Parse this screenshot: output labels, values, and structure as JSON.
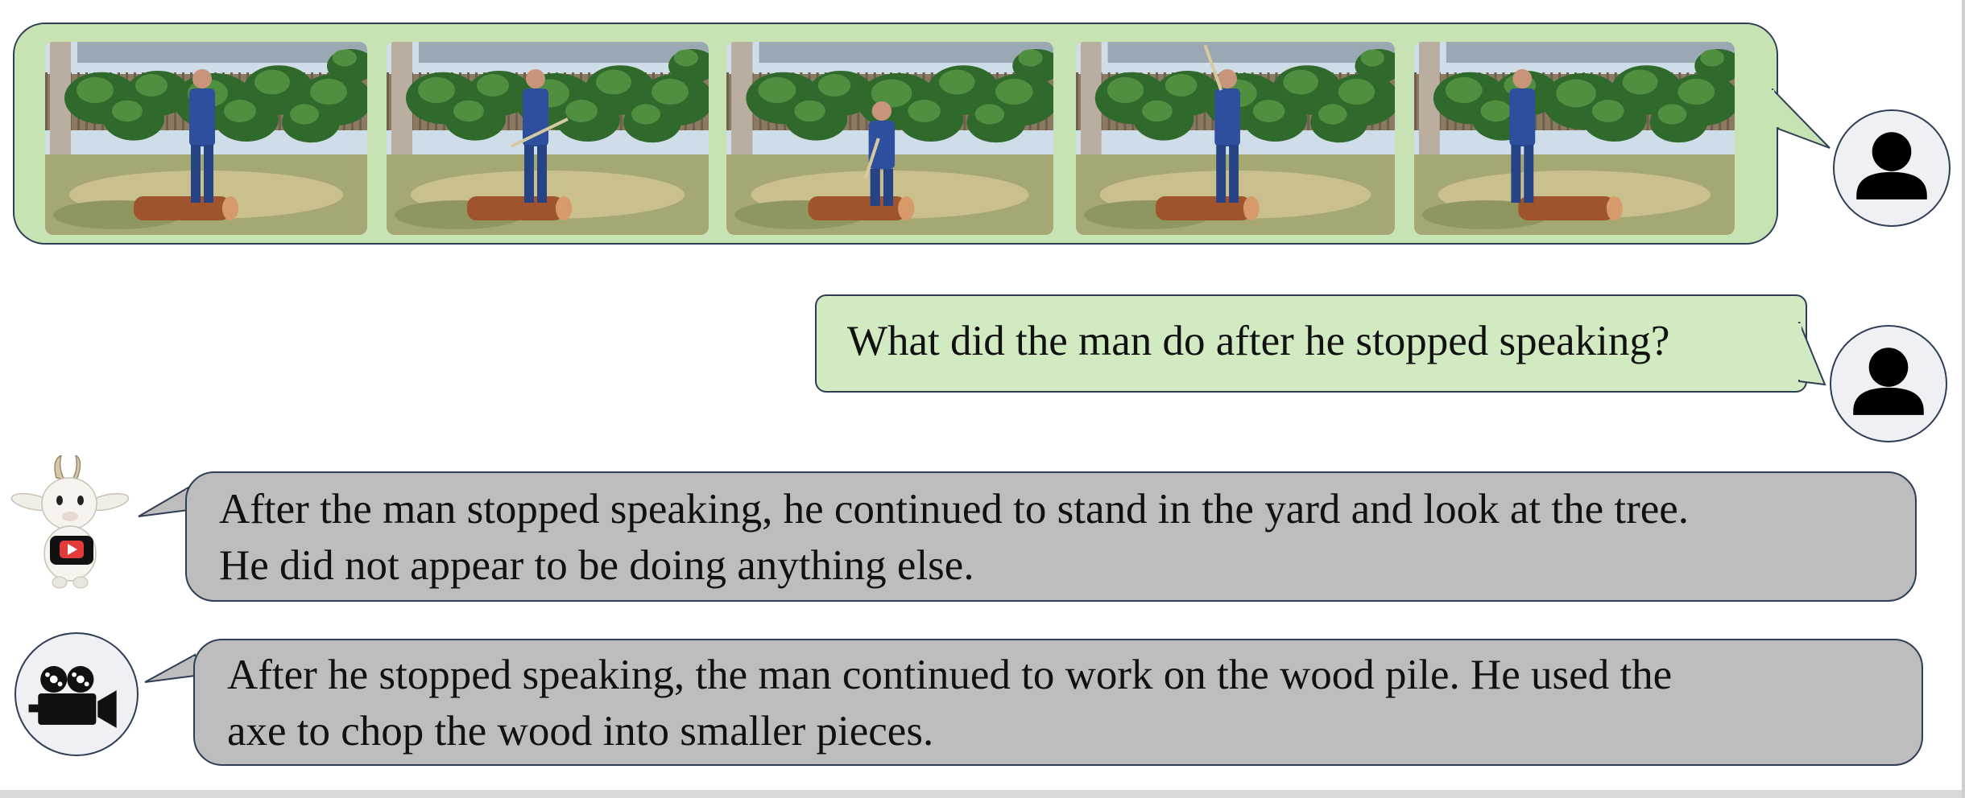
{
  "conversation": {
    "user_video": {
      "frames": [
        {
          "pose": "standing"
        },
        {
          "pose": "holding-axe"
        },
        {
          "pose": "bending"
        },
        {
          "pose": "axe-raised"
        },
        {
          "pose": "walking"
        }
      ]
    },
    "user_question": {
      "text": "What did the man do after he stopped speaking?"
    },
    "answers": [
      {
        "avatar": "goat-mascot-icon",
        "line1": "After the man stopped speaking, he continued to stand in the yard and look at the tree.",
        "line2": "He did not appear to be doing anything else."
      },
      {
        "avatar": "film-camera-icon",
        "line1": "After he stopped speaking, the man continued to work on the wood pile. He used the",
        "line2": "axe to chop the wood into smaller pieces."
      }
    ]
  },
  "colors": {
    "user_bubble": "#c8e3b3",
    "question_bubble": "#d2eac1",
    "answer_bubble": "#bdbdbd",
    "border": "#2e3e55"
  }
}
